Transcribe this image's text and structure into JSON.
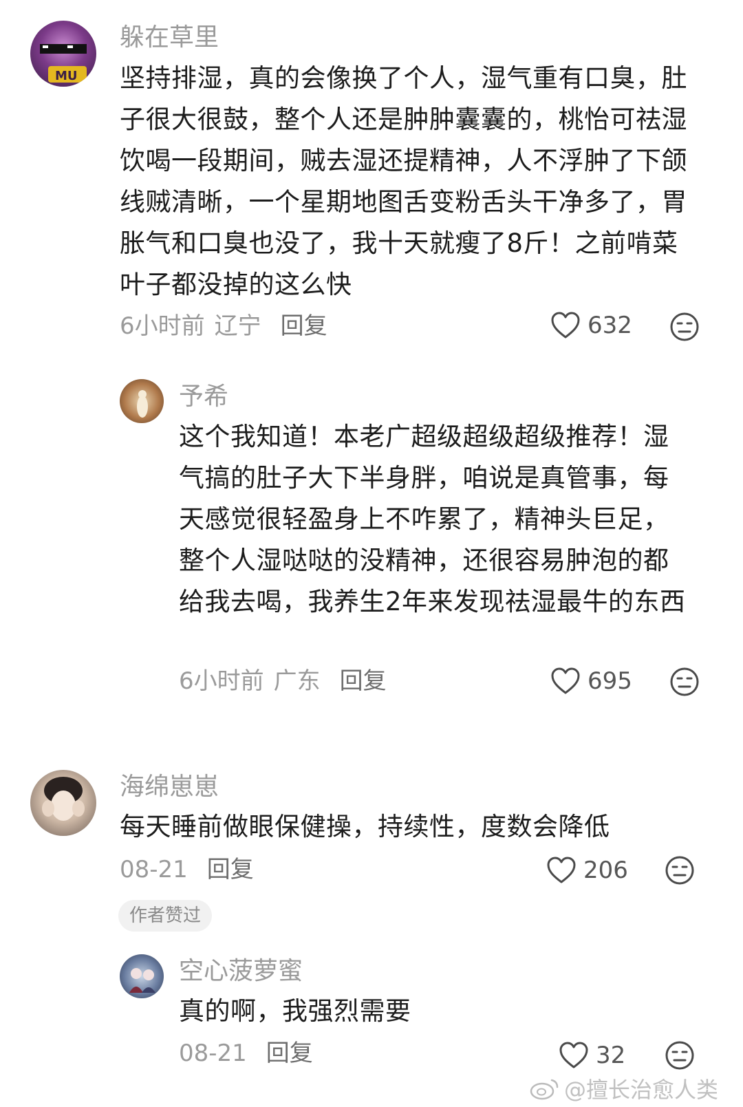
{
  "comments": [
    {
      "username": "躲在草里",
      "text": "坚持排湿，真的会像换了个人，湿气重有口臭，肚子很大很鼓，整个人还是肿肿囊囊的，桃怡可祛湿饮喝一段期间，贼去湿还提精神，人不浮肿了下颌线贼清晰，一个星期地图舌变粉舌头干净多了，胃胀气和口臭也没了，我十天就瘦了8斤！之前啃菜叶子都没掉的这么快",
      "time": "6小时前",
      "location": "辽宁",
      "reply_label": "回复",
      "likes": "632",
      "avatar_tag": "MU"
    },
    {
      "username": "予希",
      "text": "这个我知道！本老广超级超级超级推荐！湿气搞的肚子大下半身胖，咱说是真管事，每天感觉很轻盈身上不咋累了，精神头巨足，整个人湿哒哒的没精神，还很容易肿泡的都给我去喝，我养生2年来发现祛湿最牛的东西",
      "time": "6小时前",
      "location": "广东",
      "reply_label": "回复",
      "likes": "695"
    },
    {
      "username": "海绵崽崽",
      "text": "每天睡前做眼保健操，持续性，度数会降低",
      "time": "08-21",
      "reply_label": "回复",
      "likes": "206",
      "badge": "作者赞过"
    },
    {
      "username": "空心菠萝蜜",
      "text": "真的啊，我强烈需要",
      "time": "08-21",
      "reply_label": "回复",
      "likes": "32"
    }
  ],
  "watermark": "@擅长治愈人类",
  "icons": {
    "like": "heart-outline-icon",
    "dislike": "meh-face-icon",
    "watermark_logo": "weibo-logo"
  },
  "colors": {
    "text": "#1c1c1c",
    "muted": "#9a9a9a",
    "badge_bg": "#f1f1f1"
  }
}
